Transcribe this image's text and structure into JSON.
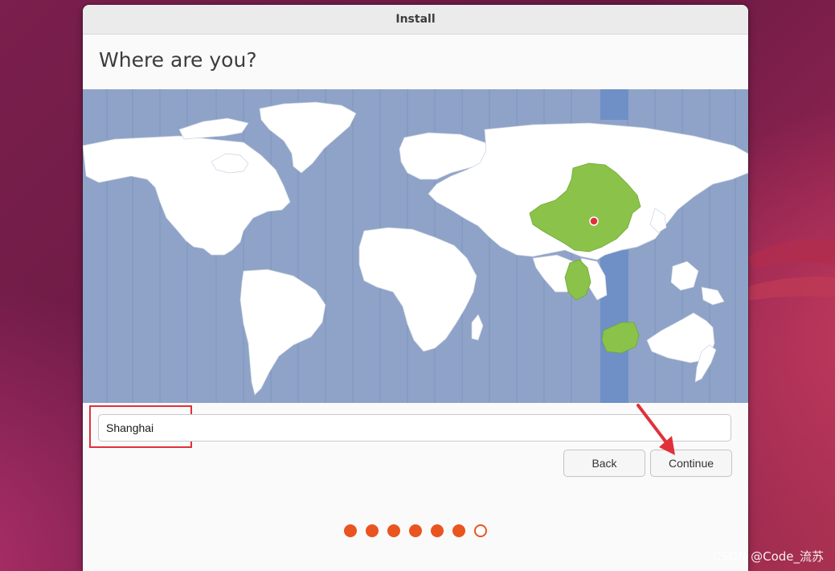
{
  "window": {
    "title": "Install"
  },
  "page": {
    "heading": "Where are you?"
  },
  "map": {
    "selected_region": "China",
    "highlight_color": "#8bc34a",
    "ocean_color": "#8fa3c8",
    "timezone_band_color": "#6f8fc7"
  },
  "location": {
    "value": "Shanghai"
  },
  "buttons": {
    "back": "Back",
    "continue": "Continue"
  },
  "progress": {
    "total_steps": 7,
    "completed_steps": 6,
    "accent_color": "#e95420"
  },
  "annotation": {
    "highlight_color": "#e0313a"
  },
  "watermark": {
    "text": "CSDN @Code_流苏"
  }
}
